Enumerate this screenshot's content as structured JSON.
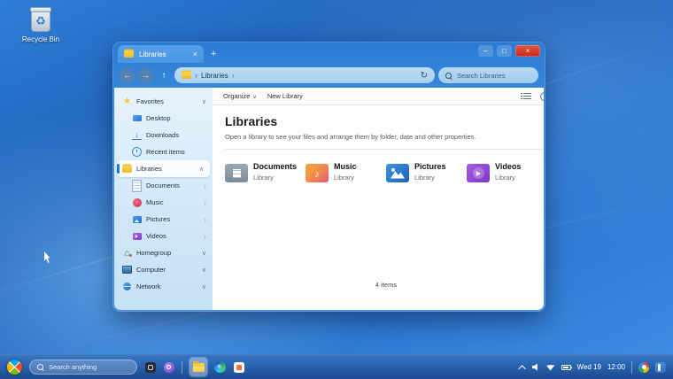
{
  "desktop": {
    "recycle_bin_label": "Recycle Bin"
  },
  "icons": {
    "back": "←",
    "forward": "→",
    "up": "↑",
    "refresh": "↻",
    "plus": "+",
    "tab_close": "×",
    "minimize": "–",
    "maximize": "□",
    "close": "×",
    "path_separator": "›",
    "organize_chevron": "∨",
    "recycle_glyph": "♻"
  },
  "window": {
    "tab_label": "Libraries",
    "address_path": "Libraries",
    "search_placeholder": "Search Libraries",
    "toolbar": {
      "organize_label": "Organize",
      "new_library_label": "New Library"
    },
    "sidebar_items": [
      {
        "label": "Favorites",
        "icon": "star",
        "level": 0,
        "chevron": "down",
        "selected": false
      },
      {
        "label": "Desktop",
        "icon": "desktop",
        "level": 1,
        "chevron": "",
        "selected": false
      },
      {
        "label": "Downloads",
        "icon": "downloads",
        "level": 1,
        "chevron": "",
        "selected": false
      },
      {
        "label": "Recent items",
        "icon": "recent",
        "level": 1,
        "chevron": "",
        "selected": false
      },
      {
        "label": "Libraries",
        "icon": "folder",
        "level": 0,
        "chevron": "up",
        "selected": true
      },
      {
        "label": "Documents",
        "icon": "documents",
        "level": 1,
        "chevron": "right",
        "selected": false
      },
      {
        "label": "Music",
        "icon": "music",
        "level": 1,
        "chevron": "right",
        "selected": false
      },
      {
        "label": "Pictures",
        "icon": "pictures",
        "level": 1,
        "chevron": "right",
        "selected": false
      },
      {
        "label": "Videos",
        "icon": "videos",
        "level": 1,
        "chevron": "right",
        "selected": false
      },
      {
        "label": "Homegroup",
        "icon": "homegroup",
        "level": 0,
        "chevron": "down",
        "selected": false
      },
      {
        "label": "Computer",
        "icon": "computer",
        "level": 0,
        "chevron": "down",
        "selected": false
      },
      {
        "label": "Network",
        "icon": "network",
        "level": 0,
        "chevron": "down",
        "selected": false
      }
    ],
    "content": {
      "title": "Libraries",
      "description": "Open a library to see your files and arrange them by folder, date and other properties.",
      "libraries": [
        {
          "name": "Documents",
          "type": "Library",
          "icon": "documents"
        },
        {
          "name": "Music",
          "type": "Library",
          "icon": "music"
        },
        {
          "name": "Pictures",
          "type": "Library",
          "icon": "pictures"
        },
        {
          "name": "Videos",
          "type": "Library",
          "icon": "videos"
        }
      ],
      "status": "4 items"
    }
  },
  "taskbar": {
    "search_placeholder": "Search anything",
    "date": "Wed 19",
    "time": "12:00"
  },
  "colors": {
    "accent": "#1e78d7",
    "close_red": "#c9281c",
    "folder_yellow": "#f2b92e",
    "taskbar_blue": "#1c4f96"
  }
}
